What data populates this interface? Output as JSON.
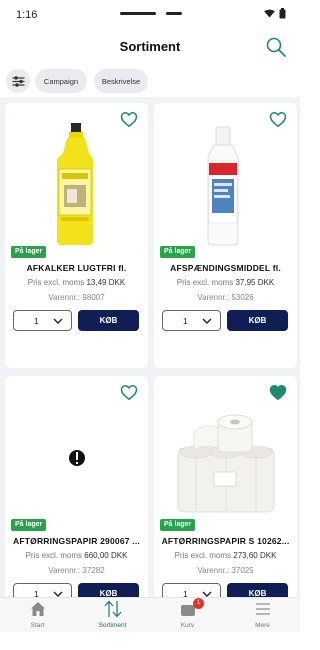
{
  "status_bar": {
    "time": "1:16"
  },
  "header": {
    "title": "Sortiment"
  },
  "filters": {
    "chips": [
      "Campaign",
      "Beskrivelse"
    ]
  },
  "colors": {
    "accent": "#1d8a72",
    "buy_button": "#0f1e55",
    "in_stock": "#27a34a",
    "badge": "#e2332b"
  },
  "products": [
    {
      "name": "AFKALKER LUGTFRI  fl.",
      "stock": "På lager",
      "price_label": "Pris excl. moms",
      "price": "13,49 DKK",
      "sku": "Varennr.: 98007",
      "qty": "1",
      "buy": "KØB",
      "favorite": false,
      "image": "yellow-bottle"
    },
    {
      "name": "AFSPÆNDINGSMIDDEL fl.",
      "stock": "På lager",
      "price_label": "Pris excl. moms",
      "price": "37,95 DKK",
      "sku": "Varennr.: 53026",
      "qty": "1",
      "buy": "KØB",
      "favorite": false,
      "image": "white-bottle"
    },
    {
      "name": "AFTØRRINGSPAPIR 290067 ...",
      "stock": "På lager",
      "price_label": "Pris excl. moms",
      "price": "660,00 DKK",
      "sku": "Varennr.: 37282",
      "qty": "1",
      "buy": "KØB",
      "favorite": false,
      "image": "missing-image"
    },
    {
      "name": "AFTØRRINGSPAPIR S 10262...",
      "stock": "På lager",
      "price_label": "Pris excl. moms",
      "price": "273,60 DKK",
      "sku": "Varennr.: 37025",
      "qty": "1",
      "buy": "KØB",
      "favorite": true,
      "image": "paper-rolls"
    }
  ],
  "nav": {
    "items": [
      {
        "label": "Start",
        "icon": "home-icon"
      },
      {
        "label": "Sortiment",
        "icon": "sort-arrows-icon",
        "active": true
      },
      {
        "label": "Kurv",
        "icon": "basket-icon",
        "badge": "1"
      },
      {
        "label": "Mere",
        "icon": "menu-icon"
      }
    ]
  }
}
